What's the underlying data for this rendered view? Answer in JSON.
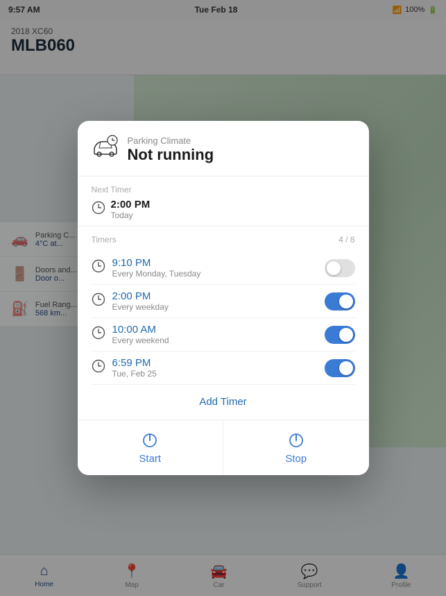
{
  "statusBar": {
    "time": "9:57 AM",
    "date": "Tue Feb 18",
    "signal": "WiFi",
    "battery": "100%"
  },
  "background": {
    "year": "2018 XC60",
    "model": "MLB060"
  },
  "bgCards": [
    {
      "icon": "🚗",
      "title": "Parking C...",
      "value": "4°C at..."
    },
    {
      "icon": "🚪",
      "title": "Doors and...",
      "value": "Door o..."
    },
    {
      "icon": "⛽",
      "title": "Fuel Rang...",
      "value": "568 km..."
    }
  ],
  "bottomNav": [
    {
      "label": "Home",
      "icon": "⌂",
      "active": true
    },
    {
      "label": "Map",
      "icon": "📍",
      "active": false
    },
    {
      "label": "Car",
      "icon": "🚘",
      "active": false
    },
    {
      "label": "Support",
      "icon": "💬",
      "active": false
    },
    {
      "label": "Profile",
      "icon": "👤",
      "active": false
    }
  ],
  "modal": {
    "headerSubtitle": "Parking Climate",
    "headerTitle": "Not running",
    "nextTimerLabel": "Next Timer",
    "nextTimerTime": "2:00 PM",
    "nextTimerDay": "Today",
    "timersLabel": "Timers",
    "timersCount": "4 / 8",
    "timers": [
      {
        "time": "9:10 PM",
        "recurrence": "Every Monday, Tuesday",
        "enabled": false
      },
      {
        "time": "2:00 PM",
        "recurrence": "Every weekday",
        "enabled": true
      },
      {
        "time": "10:00 AM",
        "recurrence": "Every weekend",
        "enabled": true
      },
      {
        "time": "6:59 PM",
        "recurrence": "Tue, Feb 25",
        "enabled": true
      }
    ],
    "addTimerLabel": "Add Timer",
    "startLabel": "Start",
    "stopLabel": "Stop"
  }
}
